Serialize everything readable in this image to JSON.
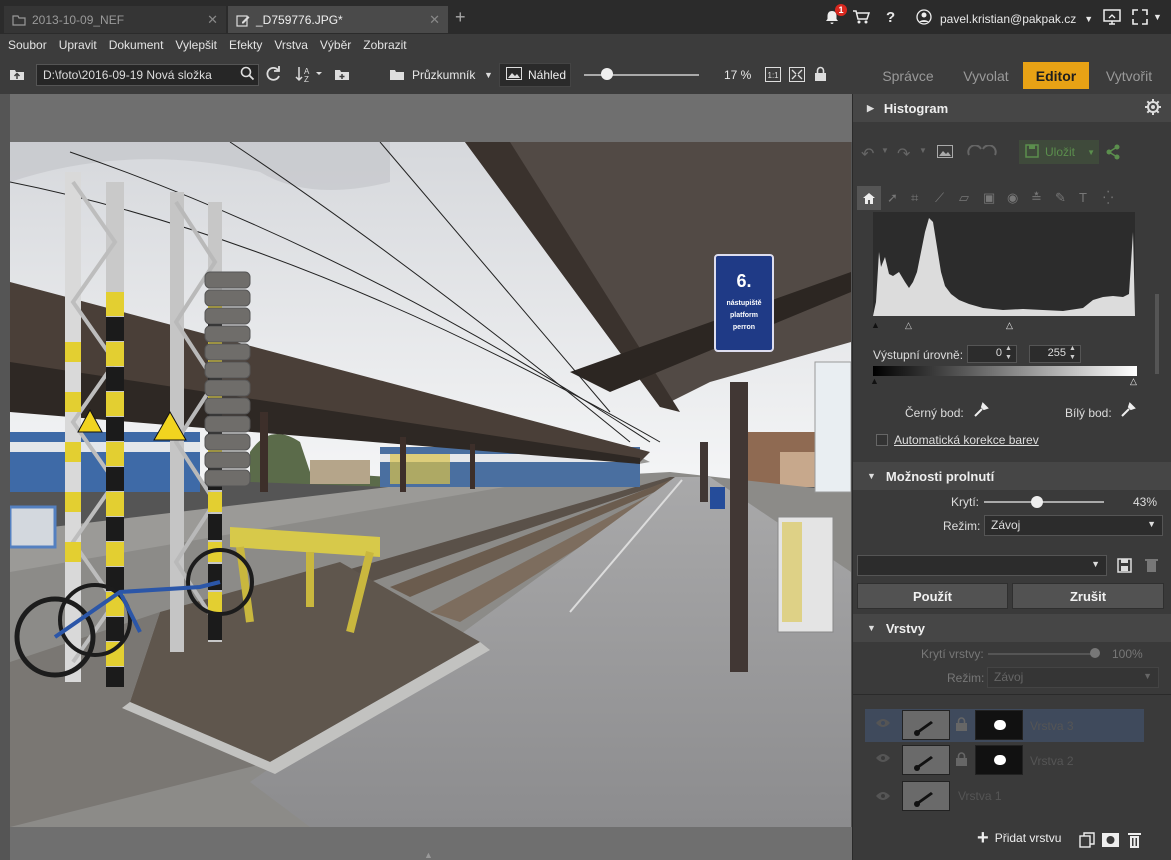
{
  "tabs": [
    {
      "label": "2013-10-09_NEF",
      "active": false
    },
    {
      "label": "_D759776.JPG*",
      "active": true
    }
  ],
  "notifications": {
    "count": "1"
  },
  "account": {
    "email": "pavel.kristian@pakpak.cz"
  },
  "menu": [
    "Soubor",
    "Upravit",
    "Dokument",
    "Vylepšit",
    "Efekty",
    "Vrstva",
    "Výběr",
    "Zobrazit"
  ],
  "toolbar": {
    "path": "D:\\foto\\2016-09-19 Nová složka",
    "explorer_label": "Průzkumník",
    "preview_label": "Náhled",
    "zoom": "17 %",
    "zoom_slider": 0.15,
    "one_to_one": "1:1"
  },
  "modes": [
    {
      "label": "Správce",
      "active": false
    },
    {
      "label": "Vyvolat",
      "active": false
    },
    {
      "label": "Editor",
      "active": true
    },
    {
      "label": "Vytvořit",
      "active": false
    }
  ],
  "photo": {
    "sign_number": "6.",
    "sign_line1": "nástupiště",
    "sign_line2": "platform",
    "sign_line3": "perron"
  },
  "histogram": {
    "title": "Histogram",
    "save_label": "Uložit",
    "output_levels_label": "Výstupní úrovně:",
    "output_min": "0",
    "output_max": "255",
    "black_point_label": "Černý bod:",
    "white_point_label": "Bílý bod:",
    "auto_color_label": "Automatická korekce barev"
  },
  "blend": {
    "title": "Možnosti prolnutí",
    "opacity_label": "Krytí:",
    "opacity_value": "43%",
    "opacity": 0.43,
    "mode_label": "Režim:",
    "mode_value": "Závoj",
    "apply_label": "Použít",
    "cancel_label": "Zrušit"
  },
  "layers": {
    "title": "Vrstvy",
    "opacity_label": "Krytí vrstvy:",
    "opacity_value": "100%",
    "mode_label": "Režim:",
    "mode_value": "Závoj",
    "items": [
      {
        "name": "Vrstva 3",
        "selected": true,
        "mask": true
      },
      {
        "name": "Vrstva 2",
        "selected": false,
        "mask": true
      },
      {
        "name": "Vrstva 1",
        "selected": false,
        "mask": false
      }
    ],
    "add_label": "Přidat vrstvu"
  },
  "colors": {
    "accent": "#e8a215",
    "panel": "#3a3a3a",
    "selected_layer": "#3f4a5c"
  }
}
